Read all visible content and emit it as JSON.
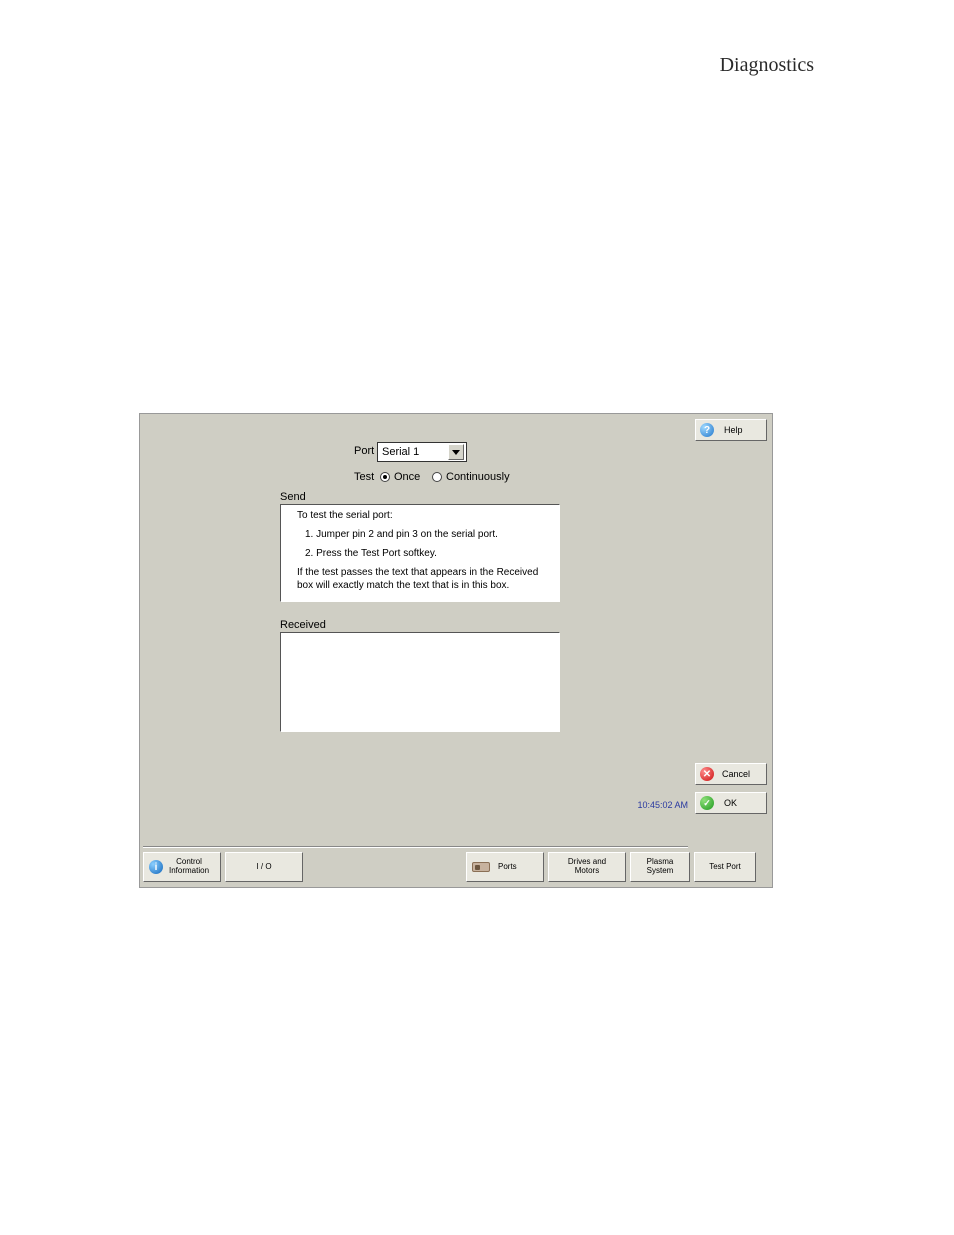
{
  "page": {
    "title": "Diagnostics"
  },
  "buttons": {
    "help": "Help",
    "cancel": "Cancel",
    "ok": "OK"
  },
  "form": {
    "port_label": "Port",
    "port_value": "Serial 1",
    "test_label": "Test",
    "radio_once": "Once",
    "radio_continuously": "Continuously",
    "radio_selected": "once",
    "send_label": "Send",
    "send_text": {
      "intro": "To test the serial port:",
      "step1": "1.  Jumper pin 2 and pin 3 on the serial port.",
      "step2": "2.  Press the Test Port softkey.",
      "note": "If the test passes the text that appears in the Received box will exactly match the text that is in this box."
    },
    "received_label": "Received",
    "received_value": ""
  },
  "clock": "10:45:02 AM",
  "softkeys": {
    "control_info": "Control\nInformation",
    "io": "I / O",
    "ports": "Ports",
    "drives_motors": "Drives and\nMotors",
    "plasma_system": "Plasma\nSystem",
    "test_port": "Test Port"
  }
}
